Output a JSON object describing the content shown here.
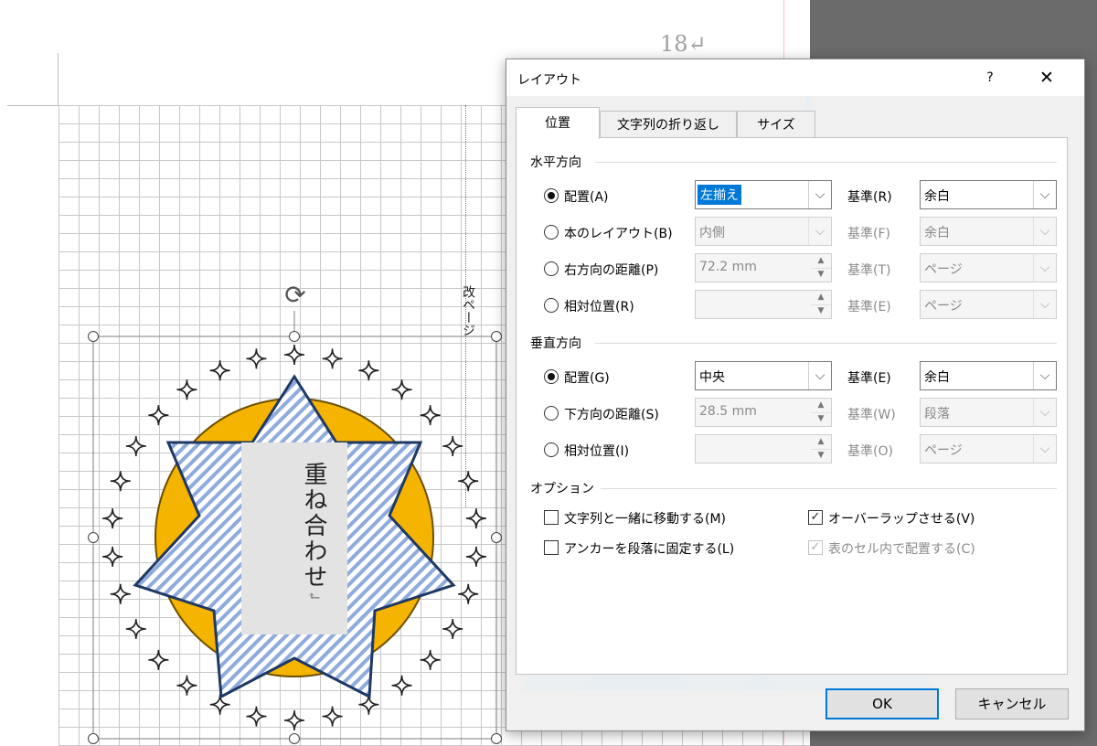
{
  "document": {
    "page_number": "18↵",
    "page_break_label": "改ページ",
    "shape_text": "重ね合わせ",
    "shape_text_mark": "↲",
    "colors": {
      "circle_fill": "#f5b400",
      "star_stroke": "#1f3864",
      "stripe": "#8faadc",
      "text_box": "#e3e3e3"
    }
  },
  "dialog": {
    "title": "レイアウト",
    "help_label": "?",
    "close_label": "✕",
    "tabs": [
      {
        "label": "位置",
        "active": true
      },
      {
        "label": "文字列の折り返し",
        "active": false
      },
      {
        "label": "サイズ",
        "active": false
      }
    ],
    "horizontal": {
      "title": "水平方向",
      "alignment": {
        "label": "配置(A)",
        "value": "左揃え",
        "ref_label": "基準(R)",
        "ref_value": "余白"
      },
      "book_layout": {
        "label": "本のレイアウト(B)",
        "value": "内側",
        "ref_label": "基準(F)",
        "ref_value": "余白"
      },
      "absolute": {
        "label": "右方向の距離(P)",
        "value": "72.2 mm",
        "ref_label": "基準(T)",
        "ref_value": "ページ"
      },
      "relative": {
        "label": "相対位置(R)",
        "value": "",
        "ref_label": "基準(E)",
        "ref_value": "ページ"
      }
    },
    "vertical": {
      "title": "垂直方向",
      "alignment": {
        "label": "配置(G)",
        "value": "中央",
        "ref_label": "基準(E)",
        "ref_value": "余白"
      },
      "absolute": {
        "label": "下方向の距離(S)",
        "value": "28.5 mm",
        "ref_label": "基準(W)",
        "ref_value": "段落"
      },
      "relative": {
        "label": "相対位置(I)",
        "value": "",
        "ref_label": "基準(O)",
        "ref_value": "ページ"
      }
    },
    "options": {
      "title": "オプション",
      "move_with_text": {
        "label": "文字列と一緒に移動する(M)",
        "checked": false
      },
      "lock_anchor": {
        "label": "アンカーを段落に固定する(L)",
        "checked": false
      },
      "allow_overlap": {
        "label": "オーバーラップさせる(V)",
        "checked": true
      },
      "layout_in_cell": {
        "label": "表のセル内で配置する(C)",
        "checked": true
      }
    },
    "buttons": {
      "ok": "OK",
      "cancel": "キャンセル"
    },
    "check_mark": "✓",
    "arrow_glyph": "⌵",
    "spin_up_glyph": "▲",
    "spin_down_glyph": "▼",
    "accent_color": "#0078d7"
  }
}
